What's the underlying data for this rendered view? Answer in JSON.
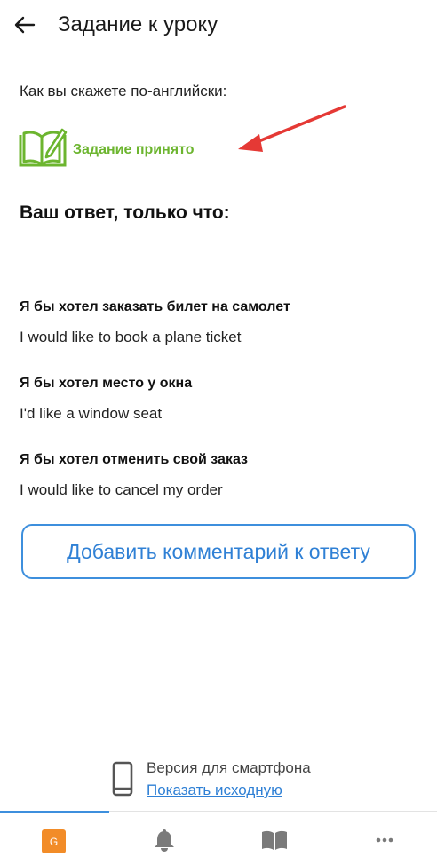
{
  "header": {
    "title": "Задание к уроку",
    "back_icon": "arrow-left-icon"
  },
  "prompt": "Как вы скажете по-английски:",
  "status": {
    "text": "Задание принято",
    "icon": "book-pencil-icon",
    "color": "#6cb52f"
  },
  "annotation": {
    "icon": "red-arrow-icon",
    "color": "#e53935"
  },
  "answer_heading": "Ваш ответ, только что:",
  "answers": [
    {
      "ru": "Я бы хотел заказать билет на самолет",
      "en": "I would like to book a plane ticket"
    },
    {
      "ru": "Я бы хотел место у окна",
      "en": "I'd like a window seat"
    },
    {
      "ru": "Я бы хотел отменить свой заказ",
      "en": "I would like to cancel my order"
    }
  ],
  "comment_button": {
    "label": "Добавить комментарий к ответу",
    "color": "#2f80d5"
  },
  "version": {
    "label": "Версия для смартфона",
    "link": "Показать исходную",
    "icon": "smartphone-icon"
  },
  "tabbar": {
    "tabs": [
      {
        "name": "home",
        "badge": "G",
        "icon": "g-badge-icon"
      },
      {
        "name": "notifications",
        "icon": "bell-icon"
      },
      {
        "name": "lessons",
        "icon": "book-icon"
      },
      {
        "name": "more",
        "icon": "more-dots-icon"
      }
    ],
    "accent": "#3d8fdd"
  }
}
